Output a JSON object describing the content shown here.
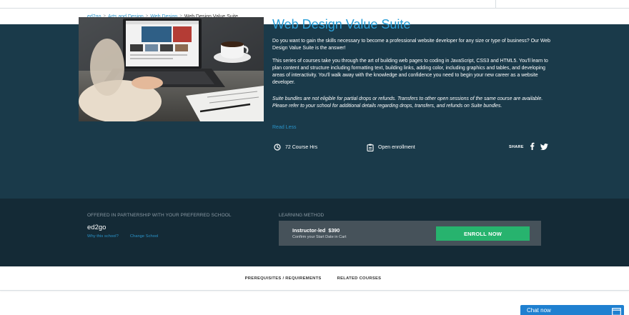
{
  "breadcrumb": {
    "items": [
      "ed2go",
      "Arts and Design",
      "Web Design"
    ],
    "separator": ">",
    "current": "Web Design Value Suite"
  },
  "course": {
    "title": "Web Design Value Suite",
    "description_1": "Do you want to gain the skills necessary to become a professional website developer for any size or type of business? Our Web Design Value Suite is the answer!",
    "description_2": "This series of courses take you through the art of building web pages to coding in JavaScript, CSS3 and HTML5. You'll learn to plan content and structure including formatting text, building links, adding color, including graphics and tables, and developing areas of interactivity. You'll walk away with the knowledge and confidence you need to begin your new career as a website developer.",
    "note": "Suite bundles are not eligible for partial drops or refunds. Transfers to other open sessions of the same course are available. Please refer to your school for additional details regarding drops, transfers, and refunds on Suite bundles.",
    "read_less": "Read Less",
    "hours": "72 Course Hrs",
    "enrollment": "Open enrollment",
    "share_label": "SHARE"
  },
  "partnership": {
    "label": "OFFERED IN PARTNERSHIP WITH YOUR PREFERRED SCHOOL",
    "school": "ed2go",
    "why_link": "Why this school?",
    "change_link": "Change School"
  },
  "method": {
    "label": "LEARNING METHOD",
    "title": "Instructor-led  $390",
    "subtitle": "Confirm your Start Date in Cart",
    "enroll_button": "ENROLL NOW"
  },
  "tabs": [
    "PREREQUISITES / REQUIREMENTS",
    "RELATED COURSES"
  ],
  "chat": {
    "label": "Chat now"
  },
  "colors": {
    "hero_bg": "#1a3a4a",
    "band_bg": "#142a36",
    "title": "#2a9fd8",
    "link": "#2a93c9",
    "enroll": "#27b36e",
    "chat": "#1f80d0"
  },
  "icons": [
    "clock-icon",
    "clipboard-icon",
    "facebook-icon",
    "twitter-icon",
    "chat-window-icon"
  ]
}
